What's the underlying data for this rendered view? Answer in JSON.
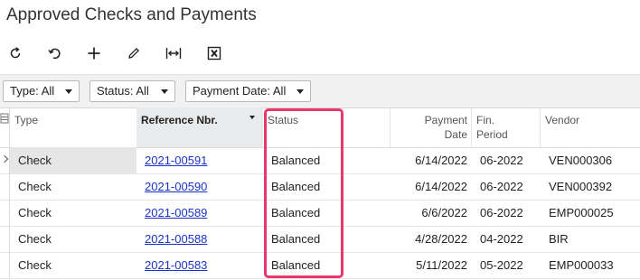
{
  "page": {
    "title": "Approved Checks and Payments"
  },
  "toolbar": {
    "buttons": [
      {
        "icon": "refresh-icon"
      },
      {
        "icon": "undo-icon"
      },
      {
        "icon": "add-icon"
      },
      {
        "icon": "edit-icon"
      },
      {
        "icon": "fit-columns-icon"
      },
      {
        "icon": "export-excel-icon"
      }
    ]
  },
  "filters": {
    "type": "Type: All",
    "status": "Status: All",
    "payment_date": "Payment Date: All"
  },
  "grid": {
    "headers": {
      "type": "Type",
      "ref": "Reference Nbr.",
      "status": "Status",
      "payment_date_1": "Payment",
      "payment_date_2": "Date",
      "fin_period_1": "Fin.",
      "fin_period_2": "Period",
      "vendor": "Vendor"
    },
    "rows": [
      {
        "type": "Check",
        "ref": "2021-00591",
        "status": "Balanced",
        "date": "6/14/2022",
        "period": "06-2022",
        "vendor": "VEN000306"
      },
      {
        "type": "Check",
        "ref": "2021-00590",
        "status": "Balanced",
        "date": "6/14/2022",
        "period": "06-2022",
        "vendor": "VEN000392"
      },
      {
        "type": "Check",
        "ref": "2021-00589",
        "status": "Balanced",
        "date": "6/6/2022",
        "period": "06-2022",
        "vendor": "EMP000025"
      },
      {
        "type": "Check",
        "ref": "2021-00588",
        "status": "Balanced",
        "date": "4/28/2022",
        "period": "04-2022",
        "vendor": "BIR"
      },
      {
        "type": "Check",
        "ref": "2021-00583",
        "status": "Balanced",
        "date": "5/11/2022",
        "period": "05-2022",
        "vendor": "EMP000033"
      }
    ]
  },
  "colors": {
    "link": "#1a33c9",
    "highlight": "#e8386a"
  }
}
